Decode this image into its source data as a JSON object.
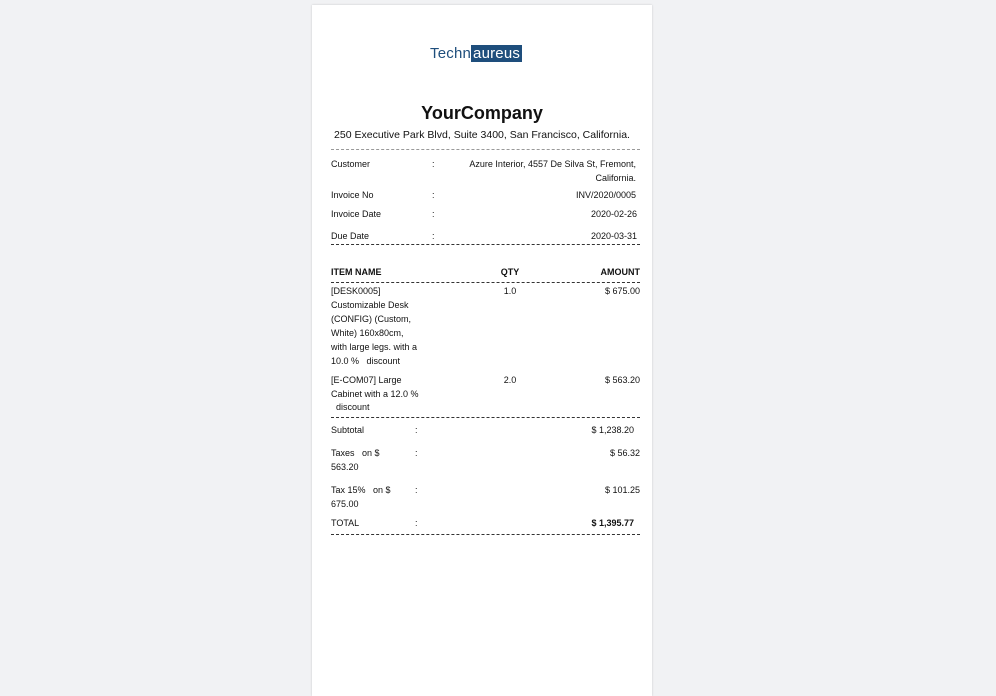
{
  "logo": {
    "part1": "Techn",
    "part2": "aureus"
  },
  "company": {
    "name": "YourCompany",
    "address": "250 Executive Park Blvd, Suite 3400, San Francisco, California."
  },
  "info": {
    "colon": ":",
    "customer": {
      "label": "Customer",
      "value_line1": "Azure Interior, 4557 De Silva St, Fremont,",
      "value_line2": "California."
    },
    "invoice_no": {
      "label": "Invoice No",
      "value": "INV/2020/0005"
    },
    "invoice_date": {
      "label": "Invoice Date",
      "value": "2020-02-26"
    },
    "due_date": {
      "label": "Due Date",
      "value": "2020-03-31"
    }
  },
  "table": {
    "headers": {
      "item": "ITEM NAME",
      "qty": "QTY",
      "amount": "AMOUNT"
    },
    "rows": [
      {
        "name_lines": [
          "[DESK0005]",
          "Customizable Desk",
          "(CONFIG) (Custom,",
          "White) 160x80cm,",
          "with large legs. with a",
          "10.0 %   discount"
        ],
        "qty": "1.0",
        "amount": "$ 675.00"
      },
      {
        "name_lines": [
          "[E-COM07] Large",
          "Cabinet with a 12.0 %",
          "  discount"
        ],
        "qty": "2.0",
        "amount": "$ 563.20"
      }
    ]
  },
  "totals": {
    "colon": ":",
    "subtotal": {
      "label": "Subtotal",
      "value": "$ 1,238.20"
    },
    "taxes": {
      "label_line1": "Taxes   on $",
      "label_line2": "563.20",
      "value": "$ 56.32"
    },
    "tax15": {
      "label_line1": "Tax 15%   on $",
      "label_line2": "675.00",
      "value": "$ 101.25"
    },
    "total": {
      "label": "TOTAL",
      "value": "$ 1,395.77"
    }
  }
}
